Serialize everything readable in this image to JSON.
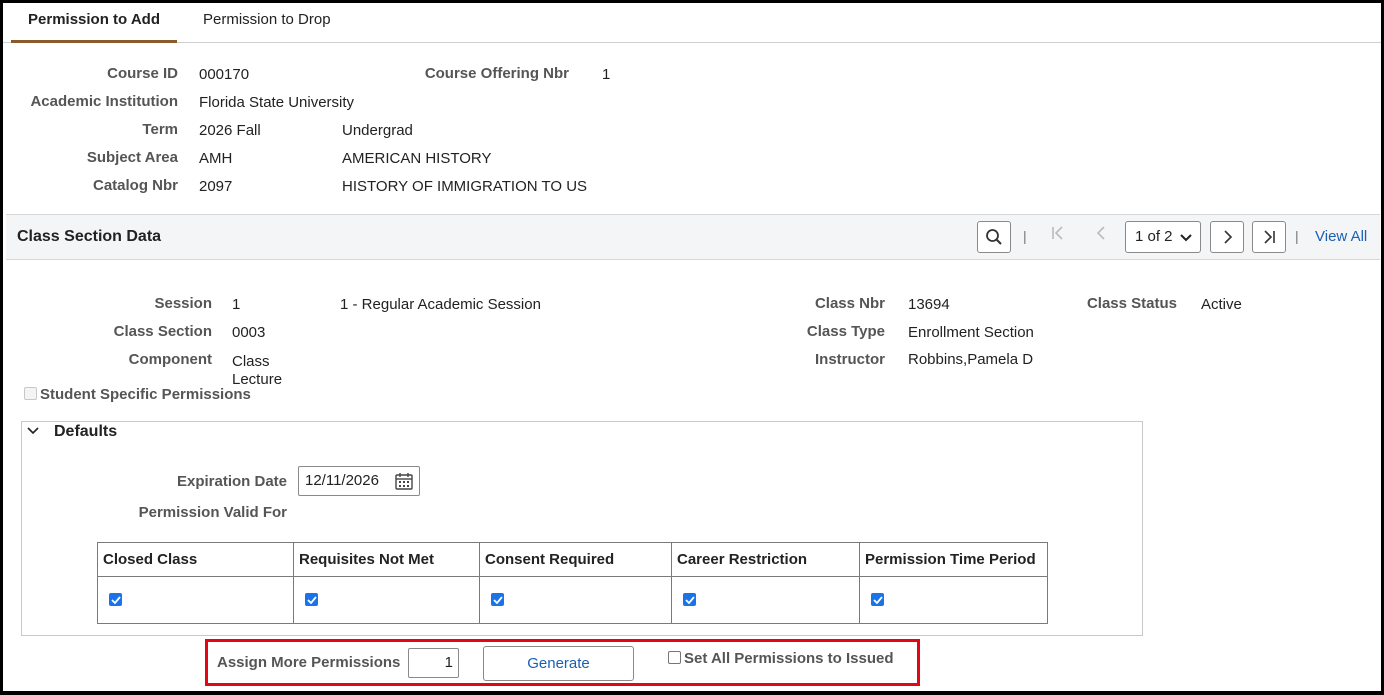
{
  "tabs": [
    {
      "label": "Permission to Add",
      "active": true
    },
    {
      "label": "Permission to Drop",
      "active": false
    }
  ],
  "course": {
    "course_id_label": "Course ID",
    "course_id": "000170",
    "offering_label": "Course Offering Nbr",
    "offering": "1",
    "institution_label": "Academic Institution",
    "institution": "Florida State University",
    "term_label": "Term",
    "term": "2026 Fall",
    "career": "Undergrad",
    "subject_label": "Subject Area",
    "subject": "AMH",
    "subject_desc": "AMERICAN HISTORY",
    "catalog_label": "Catalog Nbr",
    "catalog": "2097",
    "catalog_desc": "HISTORY OF IMMIGRATION TO US"
  },
  "section_header": {
    "title": "Class Section Data",
    "page_indicator": "1 of 2",
    "view_all": "View All",
    "separator": "|"
  },
  "class_section": {
    "session_label": "Session",
    "session": "1",
    "session_desc": "1 - Regular Academic Session",
    "class_nbr_label": "Class Nbr",
    "class_nbr": "13694",
    "status_label": "Class Status",
    "status": "Active",
    "section_label": "Class Section",
    "section": "0003",
    "type_label": "Class Type",
    "type": "Enrollment Section",
    "component_label": "Component",
    "component_line1": "Class",
    "component_line2": "Lecture",
    "instructor_label": "Instructor",
    "instructor": "Robbins,Pamela D",
    "student_specific_label": "Student Specific Permissions"
  },
  "defaults": {
    "title": "Defaults",
    "expiration_label": "Expiration Date",
    "expiration_date": "12/11/2026",
    "valid_for_label": "Permission Valid For",
    "columns": [
      "Closed Class",
      "Requisites Not Met",
      "Consent Required",
      "Career Restriction",
      "Permission Time Period"
    ],
    "checked": [
      true,
      true,
      true,
      true,
      true
    ]
  },
  "assign": {
    "label": "Assign More Permissions",
    "count": "1",
    "generate_label": "Generate",
    "set_all_label": "Set All Permissions to Issued"
  },
  "colors": {
    "accent_tab": "#8b5a2b",
    "link": "#1a5fb4",
    "checkbox": "#1a73e8",
    "highlight": "#e30613"
  }
}
